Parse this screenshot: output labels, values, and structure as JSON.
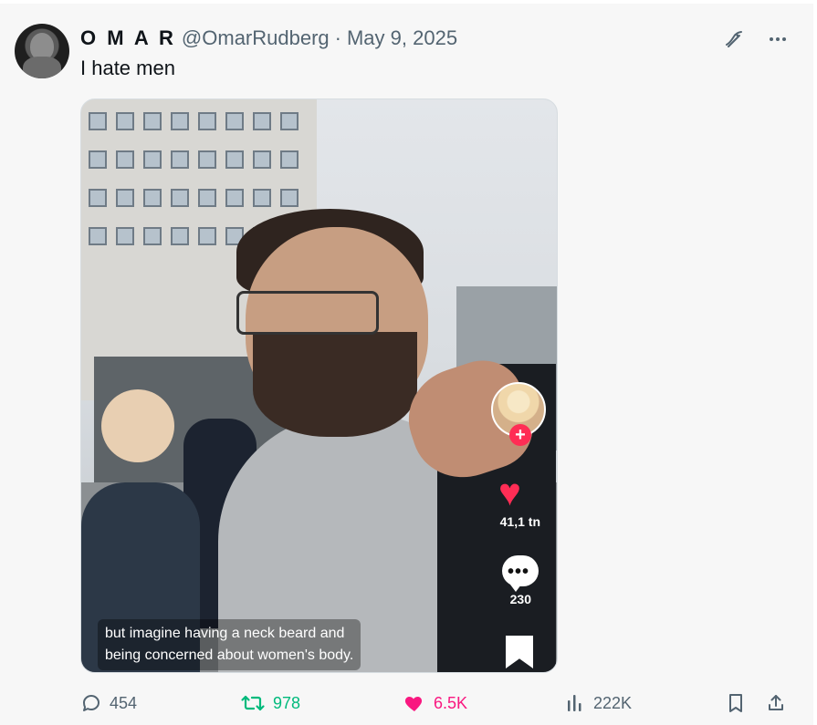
{
  "tweet": {
    "display_name": "O M A R",
    "handle": "@OmarRudberg",
    "separator": "·",
    "date": "May 9, 2025",
    "text": "I hate men"
  },
  "media": {
    "subtitle_line1": "but imagine having a neck beard and",
    "subtitle_line2": "being concerned about women's body.",
    "tiktok": {
      "like_count": "41,1 tn",
      "comment_count": "230"
    }
  },
  "actions": {
    "replies": "454",
    "retweets": "978",
    "likes": "6.5K",
    "views": "222K"
  },
  "colors": {
    "retweet": "#00ba7c",
    "like": "#f91880",
    "muted": "#536471",
    "tiktok_accent": "#ff2d55"
  },
  "icons": [
    "avatar",
    "grok-icon",
    "more-icon",
    "reply-icon",
    "retweet-icon",
    "heart-icon",
    "views-icon",
    "bookmark-icon",
    "share-icon",
    "tiktok-heart-icon",
    "tiktok-comment-icon",
    "tiktok-bookmark-icon"
  ]
}
